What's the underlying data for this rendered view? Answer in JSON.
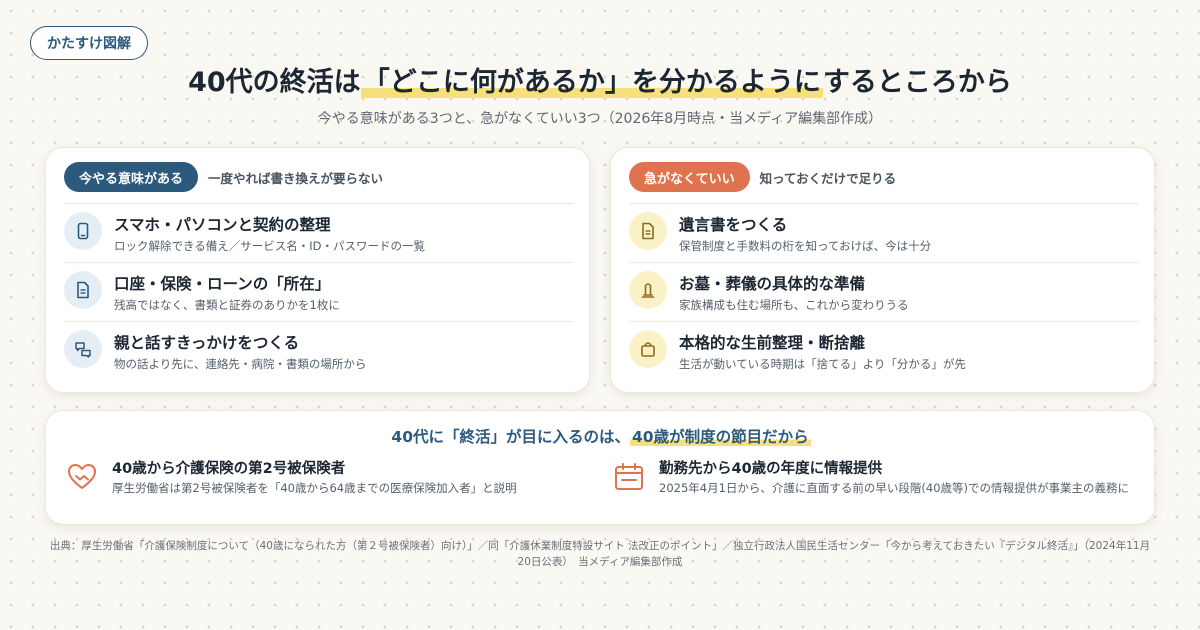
{
  "brand": "かたすけ図解",
  "title": {
    "before": "40代の終活は",
    "highlight": "「どこに何があるか」を分かるように",
    "after": "するところから"
  },
  "subtitle": "今やる意味がある3つと、急がなくていい3つ（2026年8月時点・当メディア編集部作成）",
  "left_card": {
    "pill": "今やる意味がある",
    "note": "一度やれば書き換えが要らない",
    "items": [
      {
        "title": "スマホ・パソコンと契約の整理",
        "desc": "ロック解除できる備え／サービス名・ID・パスワードの一覧",
        "icon": "smartphone-icon"
      },
      {
        "title": "口座・保険・ローンの「所在」",
        "desc": "残高ではなく、書類と証券のありかを1枚に",
        "icon": "document-icon"
      },
      {
        "title": "親と話すきっかけをつくる",
        "desc": "物の話より先に、連絡先・病院・書類の場所から",
        "icon": "chat-icon"
      }
    ]
  },
  "right_card": {
    "pill": "急がなくていい",
    "note": "知っておくだけで足りる",
    "items": [
      {
        "title": "遺言書をつくる",
        "desc": "保管制度と手数料の桁を知っておけば、今は十分",
        "icon": "document-icon"
      },
      {
        "title": "お墓・葬儀の具体的な準備",
        "desc": "家族構成も住む場所も、これから変わりうる",
        "icon": "grave-icon"
      },
      {
        "title": "本格的な生前整理・断捨離",
        "desc": "生活が動いている時期は「捨てる」より「分かる」が先",
        "icon": "bag-icon"
      }
    ]
  },
  "bottom": {
    "heading_before": "40代に「終活」が目に入るのは、",
    "heading_highlight": "40歳が制度の節目だから",
    "facts": [
      {
        "title": "40歳から介護保険の第2号被保険者",
        "desc": "厚生労働省は第2号被保険者を「40歳から64歳までの医療保険加入者」と説明",
        "icon": "heart-hands-icon"
      },
      {
        "title": "勤務先から40歳の年度に情報提供",
        "desc": "2025年4月1日から、介護に直面する前の早い段階(40歳等)での情報提供が事業主の義務に",
        "icon": "calendar-icon"
      }
    ]
  },
  "source": "出典：厚生労働省「介護保険制度について（40歳になられた方（第２号被保険者）向け）」／同「介護休業制度特設サイト 法改正のポイント」／独立行政法人国民生活センター「今から考えておきたい『デジタル終活』」（2024年11月20日公表）　当メディア編集部作成",
  "colors": {
    "navy": "#2c5a7d",
    "orange": "#e0734f",
    "highlight": "#f7e07a"
  }
}
